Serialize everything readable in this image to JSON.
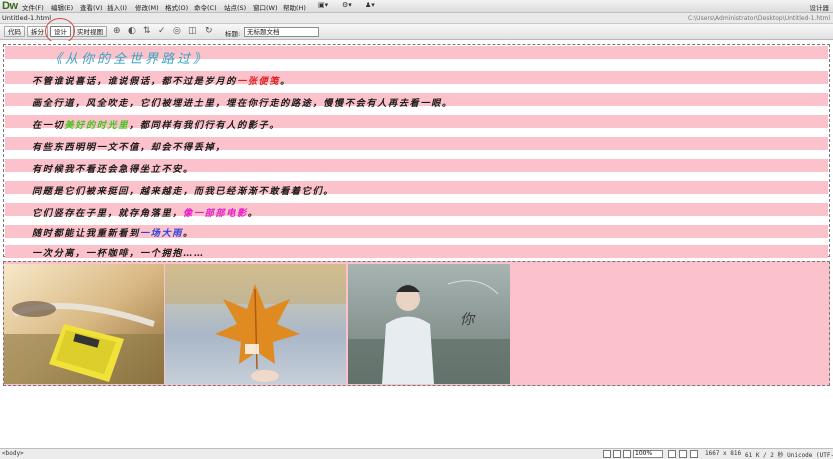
{
  "app": {
    "logo": "Dw",
    "menu": [
      "文件(F)",
      "编辑(E)",
      "查看(V)",
      "插入(I)",
      "修改(M)",
      "格式(O)",
      "命令(C)",
      "站点(S)",
      "窗口(W)",
      "帮助(H)"
    ],
    "workspace": "设计器"
  },
  "document": {
    "tab": "Untitled-1.html",
    "path": "C:\\Users\\Administrator\\Desktop\\Untitled-1.html"
  },
  "toolbar": {
    "code": "代码",
    "split": "拆分",
    "design": "设计",
    "live": "实时视图",
    "title_label": "标题:",
    "title_value": "无标题文档"
  },
  "content": {
    "title": "《从你的全世界路过》",
    "lines": [
      {
        "pre": "不管谁说喜话，谁说假话，都不过是岁月的",
        "hl": "一张便笺",
        "post": "。",
        "hl_color": "red"
      },
      {
        "pre": "画全行道，风全吹走，它们被埋进土里，埋在你行走的路途，慢慢不会有人再去看一眼。",
        "hl": "",
        "post": "",
        "hl_color": ""
      },
      {
        "pre": "在一切",
        "hl": "美好的时光里",
        "post": "，都同样有我们行有人的影子。",
        "hl_color": "green"
      },
      {
        "pre": "有些东西明明一文不值，却会不得丢掉，",
        "hl": "",
        "post": "",
        "hl_color": ""
      },
      {
        "pre": "有时候我不看还会急得坐立不安。",
        "hl": "",
        "post": "",
        "hl_color": ""
      },
      {
        "pre": "同题是它们被来挺回，越来越走，而我已经渐渐不敢看着它们。",
        "hl": "",
        "post": "",
        "hl_color": ""
      },
      {
        "pre": "它们竖存在子里，就存角落里，",
        "hl": "像一部部电影",
        "post": "。",
        "hl_color": "magenta"
      },
      {
        "pre": "随时都能让我重新看到",
        "hl": "一场大雨",
        "post": "。",
        "hl_color": "blue"
      },
      {
        "pre": "一次分离，一杯咖啡，一个拥抱……",
        "hl": "",
        "post": "",
        "hl_color": ""
      }
    ]
  },
  "status": {
    "tag": "<body>",
    "zoom": "100%",
    "size": "1667 x 816",
    "weight": "61 K / 2 秒 Unicode (UTF-8)"
  },
  "colors": {
    "stripe": "#fcc2cb",
    "title": "#36a4c3",
    "red": "#e02020",
    "green": "#42c51c",
    "magenta": "#e71ac7",
    "blue": "#2f45d6",
    "annotation_circle": "#d64545"
  }
}
